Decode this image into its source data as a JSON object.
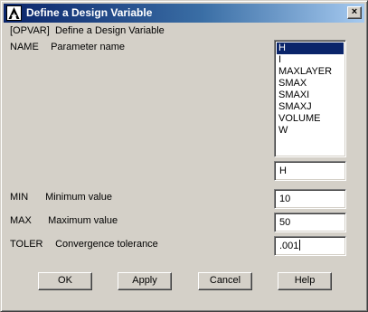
{
  "window": {
    "title": "Define a Design Variable",
    "close_label": "×"
  },
  "header": {
    "command": "[OPVAR]",
    "description": "Define a Design Variable"
  },
  "name_field": {
    "key": "NAME",
    "label": "Parameter name",
    "options": [
      "H",
      "I",
      "MAXLAYER",
      "SMAX",
      "SMAXI",
      "SMAXJ",
      "VOLUME",
      "W"
    ],
    "selected": "H",
    "value": "H"
  },
  "min_field": {
    "key": "MIN",
    "label": "Minimum value",
    "value": "10"
  },
  "max_field": {
    "key": "MAX",
    "label": "Maximum value",
    "value": "50"
  },
  "toler_field": {
    "key": "TOLER",
    "label": "Convergence tolerance",
    "value": ".001"
  },
  "buttons": {
    "ok": "OK",
    "apply": "Apply",
    "cancel": "Cancel",
    "help": "Help"
  },
  "colors": {
    "titlebar_start": "#0a246a",
    "titlebar_end": "#a6caf0",
    "dialog_bg": "#d4d0c8",
    "selection": "#0a246a"
  },
  "icons": {
    "app": "ansys-logo-icon",
    "close": "close-icon"
  }
}
